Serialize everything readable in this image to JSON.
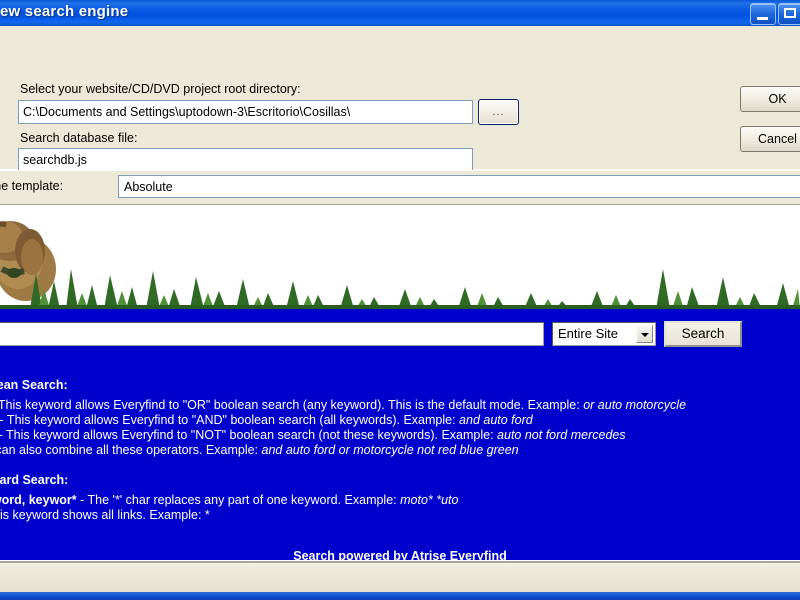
{
  "window": {
    "title": "ew search engine",
    "minimize_icon": "minimize-icon",
    "maximize_icon": "maximize-icon"
  },
  "dialog": {
    "path_label": "Select your website/CD/DVD project root directory:",
    "path_value": "C:\\Documents and Settings\\uptodown-3\\Escritorio\\Cosillas\\",
    "browse_label": "...",
    "dbfile_label": "Search database file:",
    "dbfile_value": "searchdb.js",
    "ok_label": "OK",
    "cancel_label": "Cancel"
  },
  "template": {
    "label": "ch engine template:",
    "value": "Absolute"
  },
  "preview": {
    "search_value": "",
    "scope_value": "Entire Site",
    "search_button_label": "Search",
    "boolean_heading": "oolean Search:",
    "boolean_lines": [
      "R - This keyword allows Everyfind to \"OR\" boolean search (any keyword). This is the default mode. Example: or auto motorcycle",
      "ND - This keyword allows Everyfind to \"AND\" boolean search (all keywords). Example: and auto ford",
      "OT - This keyword allows Everyfind to \"NOT\" boolean search (not these keywords). Example: auto not ford mercedes",
      "ou can also combine all these operators. Example: and auto ford or motorcycle not red blue green"
    ],
    "boolean_line_prefixes": [
      "R - This keyword allows Everyfind to \"OR\" boolean search (any keyword). This is the default mode. Example: ",
      "ND - This keyword allows Everyfind to \"AND\" boolean search (all keywords). Example: ",
      "OT - This keyword allows Everyfind to \"NOT\" boolean search (not these keywords). Example: ",
      "ou can also combine all these operators. Example: "
    ],
    "boolean_line_examples": [
      "or auto motorcycle",
      "and auto ford",
      "auto not ford mercedes",
      "and auto ford or motorcycle not red blue green"
    ],
    "wildcard_heading": "ildcard Search:",
    "wildcard_line1_bold": "eyword, keywor*",
    "wildcard_line1_text": " - The '*' char replaces any part of one keyword. Example: ",
    "wildcard_line1_example": "moto* *uto",
    "wildcard_line2_text": " - This keyword shows all links. Example: *",
    "powered_text": "Search powered by Atrise Everyfind"
  },
  "colors": {
    "page_blue": "#0000cc",
    "title_blue": "#0a5ae2",
    "dialog_face": "#ece9d8"
  }
}
